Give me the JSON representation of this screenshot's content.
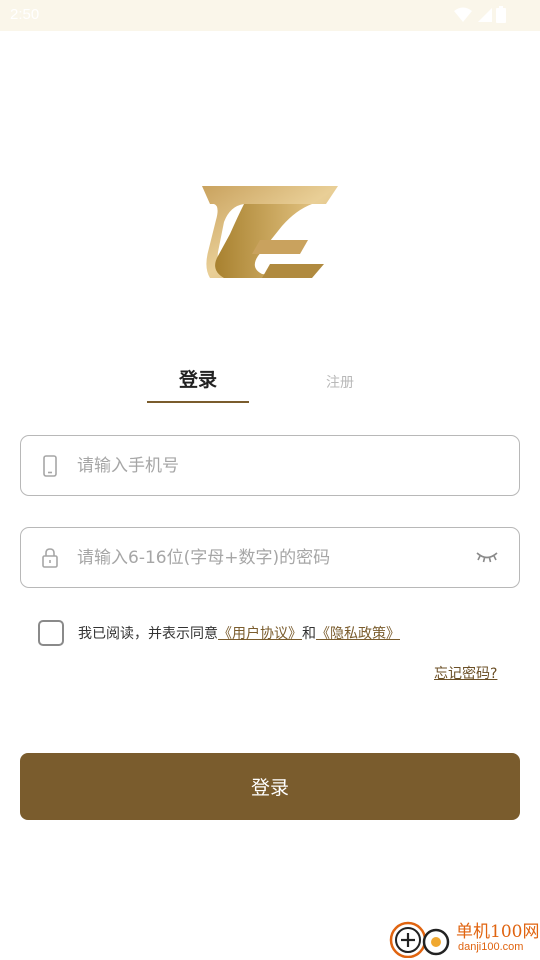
{
  "status_bar": {
    "time": "2:50",
    "icons": [
      "wifi-icon",
      "signal-icon",
      "battery-icon"
    ]
  },
  "tabs": {
    "login": "登录",
    "register": "注册"
  },
  "phone_field": {
    "placeholder": "请输入手机号",
    "value": "",
    "icon": "phone-icon"
  },
  "password_field": {
    "placeholder": "请输入6-16位(字母+数字)的密码",
    "value": "",
    "icon": "lock-icon",
    "toggle_icon": "eye-closed-icon"
  },
  "agreement": {
    "checked": false,
    "prefix": "我已阅读，并表示同意",
    "user_agreement": "《用户协议》",
    "conjunction": "和",
    "privacy_policy": "《隐私政策》"
  },
  "forgot_password": "忘记密码?",
  "login_button": "登录",
  "watermark": {
    "cn": "单机100网",
    "url": "danji100.com"
  },
  "colors": {
    "accent": "#7a5c2d",
    "status_bar_bg": "#faf6ea",
    "placeholder": "#a6a6a6",
    "border": "#b8b8b8",
    "watermark": "#e06410"
  }
}
